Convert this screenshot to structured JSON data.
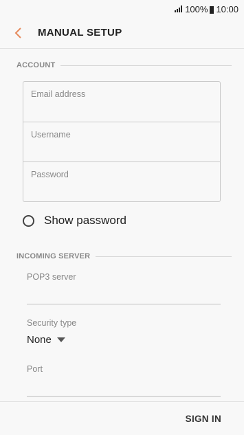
{
  "status": {
    "battery": "100%",
    "time": "10:00"
  },
  "appbar": {
    "title": "MANUAL SETUP",
    "accent": "#e68a5c"
  },
  "account": {
    "section_label": "ACCOUNT",
    "email_placeholder": "Email address",
    "username_placeholder": "Username",
    "password_placeholder": "Password",
    "show_password_label": "Show password"
  },
  "incoming": {
    "section_label": "INCOMING SERVER",
    "server_placeholder": "POP3 server",
    "security_label": "Security type",
    "security_value": "None",
    "port_placeholder": "Port"
  },
  "footer": {
    "sign_in_label": "SIGN IN"
  }
}
